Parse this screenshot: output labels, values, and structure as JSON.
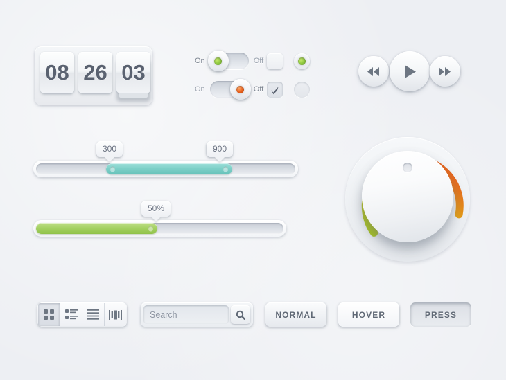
{
  "theme": {
    "background": "#edeff3",
    "text_dark": "#5a6270",
    "text_muted": "#9aa2ae",
    "led_green": "#8cc63e",
    "led_orange": "#e8601c",
    "slider_teal": "#7ed0c8",
    "slider_green": "#a6d265",
    "knob_arc_start": "#a8c81e",
    "knob_arc_mid": "#e3a317",
    "knob_arc_end": "#e8501e"
  },
  "flip_clock": {
    "name": "flip-clock",
    "digits": [
      {
        "value": "08",
        "flipping": false
      },
      {
        "value": "26",
        "flipping": false
      },
      {
        "value": "03",
        "flipping": true
      }
    ]
  },
  "toggles": [
    {
      "on_label": "On",
      "off_label": "Off",
      "state": "on",
      "knob_position": "left",
      "led_color": "green",
      "active_side": "on"
    },
    {
      "on_label": "On",
      "off_label": "Off",
      "state": "off",
      "knob_position": "right",
      "led_color": "orange",
      "active_side": "off"
    }
  ],
  "checkboxes": [
    {
      "checked": false,
      "icon": "checkbox-empty-icon"
    },
    {
      "checked": true,
      "icon": "checkmark-icon"
    }
  ],
  "radios": [
    {
      "selected": true,
      "icon": "radio-selected-icon",
      "led_color": "green"
    },
    {
      "selected": false,
      "icon": "radio-empty-icon"
    }
  ],
  "media_buttons": [
    {
      "action": "rewind",
      "icon": "rewind-icon",
      "size": "small"
    },
    {
      "action": "play",
      "icon": "play-icon",
      "size": "large"
    },
    {
      "action": "fast-forward",
      "icon": "fast-forward-icon",
      "size": "small"
    }
  ],
  "sliders": [
    {
      "name": "range-slider",
      "type": "range",
      "fill_color": "teal",
      "min_value": "300",
      "max_value": "900",
      "low_percent": 29,
      "high_percent": 75,
      "tooltips": [
        "300",
        "900"
      ]
    },
    {
      "name": "progress-slider",
      "type": "single",
      "fill_color": "green",
      "value": "50%",
      "percent": 50,
      "tooltips": [
        "50%"
      ]
    }
  ],
  "knob": {
    "name": "rotary-knob",
    "arc_start_deg": 215,
    "arc_end_deg": 140,
    "indicator": "knob-indicator-dot"
  },
  "segmented_control": {
    "segments": [
      {
        "icon": "grid-view-icon",
        "label": "Grid view",
        "selected": true
      },
      {
        "icon": "list-view-icon",
        "label": "List view",
        "selected": false
      },
      {
        "icon": "lines-view-icon",
        "label": "Lines view",
        "selected": false
      },
      {
        "icon": "coverflow-view-icon",
        "label": "Cover flow view",
        "selected": false
      }
    ]
  },
  "search": {
    "placeholder": "Search",
    "value": "",
    "button_icon": "search-icon"
  },
  "push_buttons": [
    {
      "label": "NORMAL",
      "state": "normal"
    },
    {
      "label": "HOVER",
      "state": "hover"
    },
    {
      "label": "PRESS",
      "state": "press"
    }
  ]
}
